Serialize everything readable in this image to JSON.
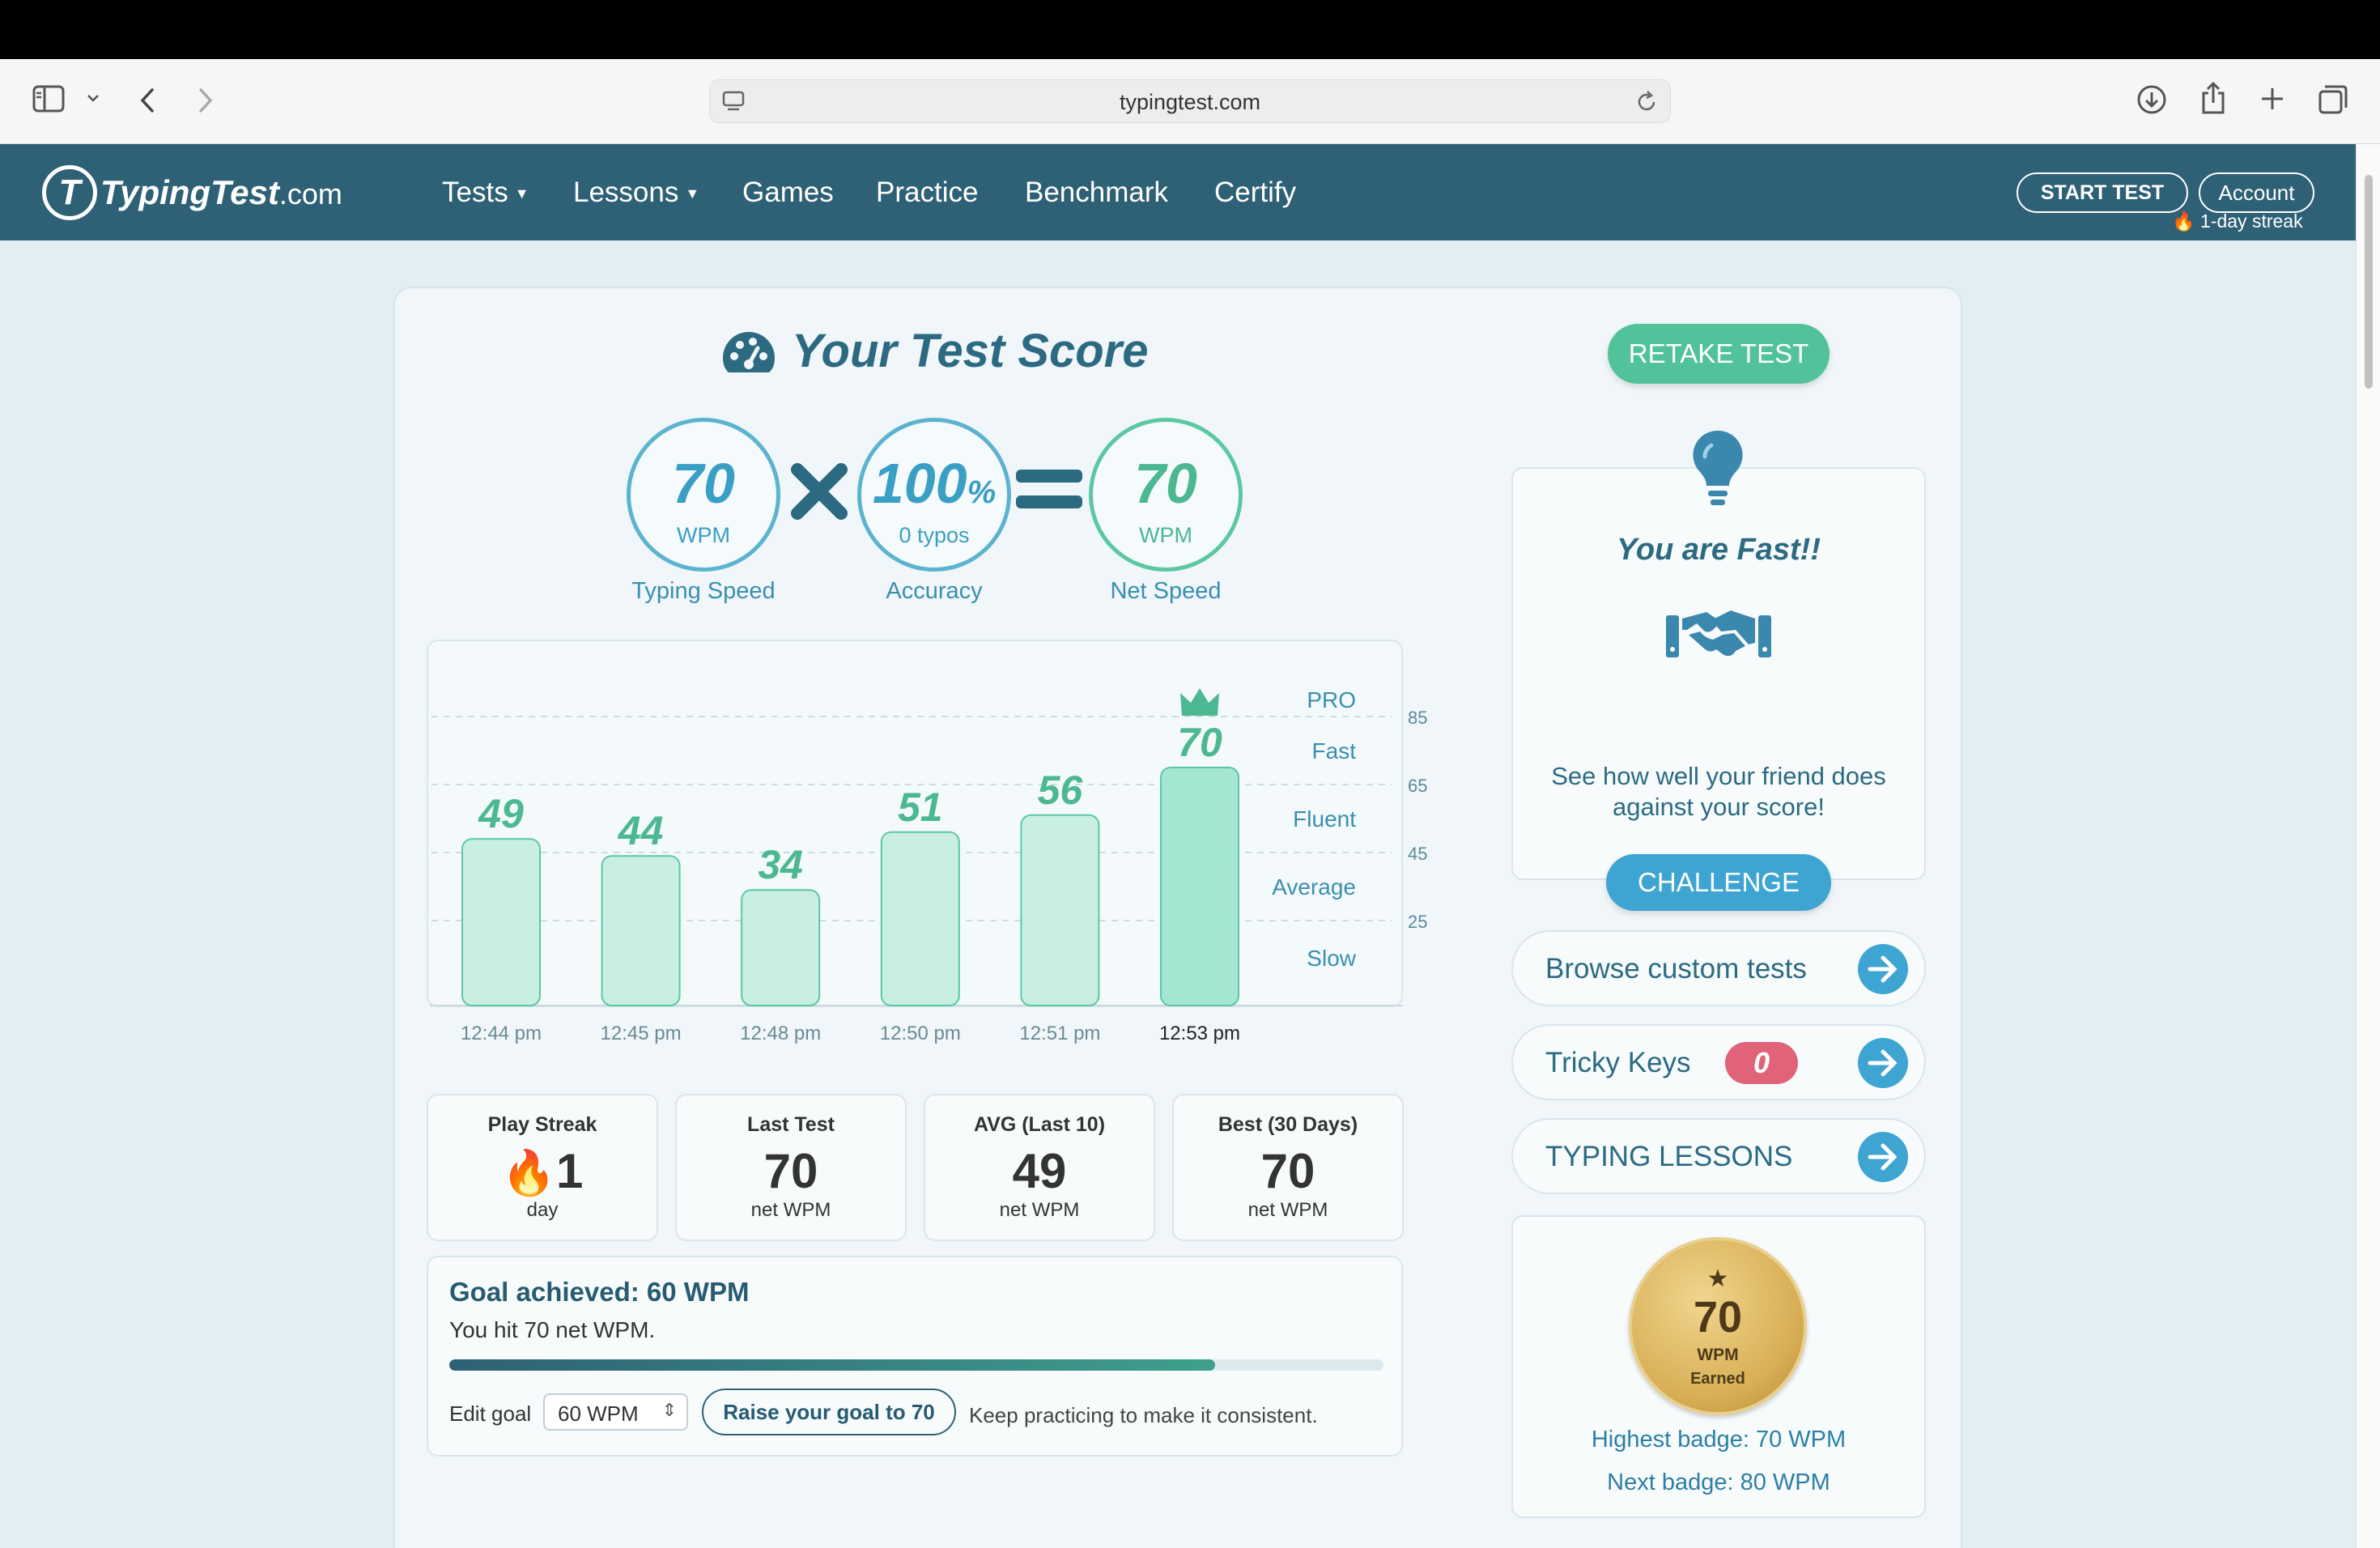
{
  "browser": {
    "url": "typingtest.com"
  },
  "nav": {
    "logo_main": "TypingTest",
    "logo_com": ".com",
    "items": [
      "Tests",
      "Lessons",
      "Games",
      "Practice",
      "Benchmark",
      "Certify"
    ],
    "start_test": "START TEST",
    "account": "Account",
    "streak": "🔥 1-day streak"
  },
  "score": {
    "title": "Your Test Score",
    "speed": {
      "value": "70",
      "unit": "WPM",
      "label": "Typing Speed"
    },
    "accuracy": {
      "value": "100",
      "percent": "%",
      "unit": "0 typos",
      "label": "Accuracy"
    },
    "net": {
      "value": "70",
      "unit": "WPM",
      "label": "Net Speed"
    }
  },
  "chart_data": {
    "type": "bar",
    "categories": [
      "12:44 pm",
      "12:45 pm",
      "12:48 pm",
      "12:50 pm",
      "12:51 pm",
      "12:53 pm"
    ],
    "values": [
      49,
      44,
      34,
      51,
      56,
      70
    ],
    "ylim": [
      0,
      95
    ],
    "yticks": [
      85,
      65,
      45,
      25
    ],
    "bands": [
      "PRO",
      "Fast",
      "Fluent",
      "Average",
      "Slow"
    ],
    "highlight_index": 5,
    "grid": "dashed"
  },
  "stats": [
    {
      "title": "Play Streak",
      "value": "1",
      "sub": "day",
      "icon": "🔥"
    },
    {
      "title": "Last Test",
      "value": "70",
      "sub": "net WPM"
    },
    {
      "title": "AVG (Last 10)",
      "value": "49",
      "sub": "net WPM"
    },
    {
      "title": "Best (30 Days)",
      "value": "70",
      "sub": "net WPM"
    }
  ],
  "goal": {
    "title": "Goal achieved: 60 WPM",
    "subtitle": "You hit 70 net WPM.",
    "progress": 0.82,
    "edit_label": "Edit goal",
    "select_value": "60 WPM",
    "raise_label": "Raise your goal to 70",
    "keep_text": "Keep practicing to make it consistent."
  },
  "side": {
    "retake": "RETAKE TEST",
    "fast_title": "You are Fast!!",
    "fast_desc": "See how well your friend does against your score!",
    "challenge": "CHALLENGE",
    "browse": "Browse custom tests",
    "tricky": "Tricky Keys",
    "tricky_count": "0",
    "lessons": "TYPING LESSONS"
  },
  "badge": {
    "value": "70",
    "unit": "WPM",
    "earned": "Earned",
    "highest": "Highest badge: 70 WPM",
    "next": "Next badge: 80 WPM"
  },
  "colors": {
    "nav": "#2e6175",
    "accent_green": "#52c29a",
    "accent_blue": "#3ea5d2",
    "bar": "#c8efe2",
    "bar_highlight": "#a5e6d2",
    "tricky": "#e06379"
  }
}
